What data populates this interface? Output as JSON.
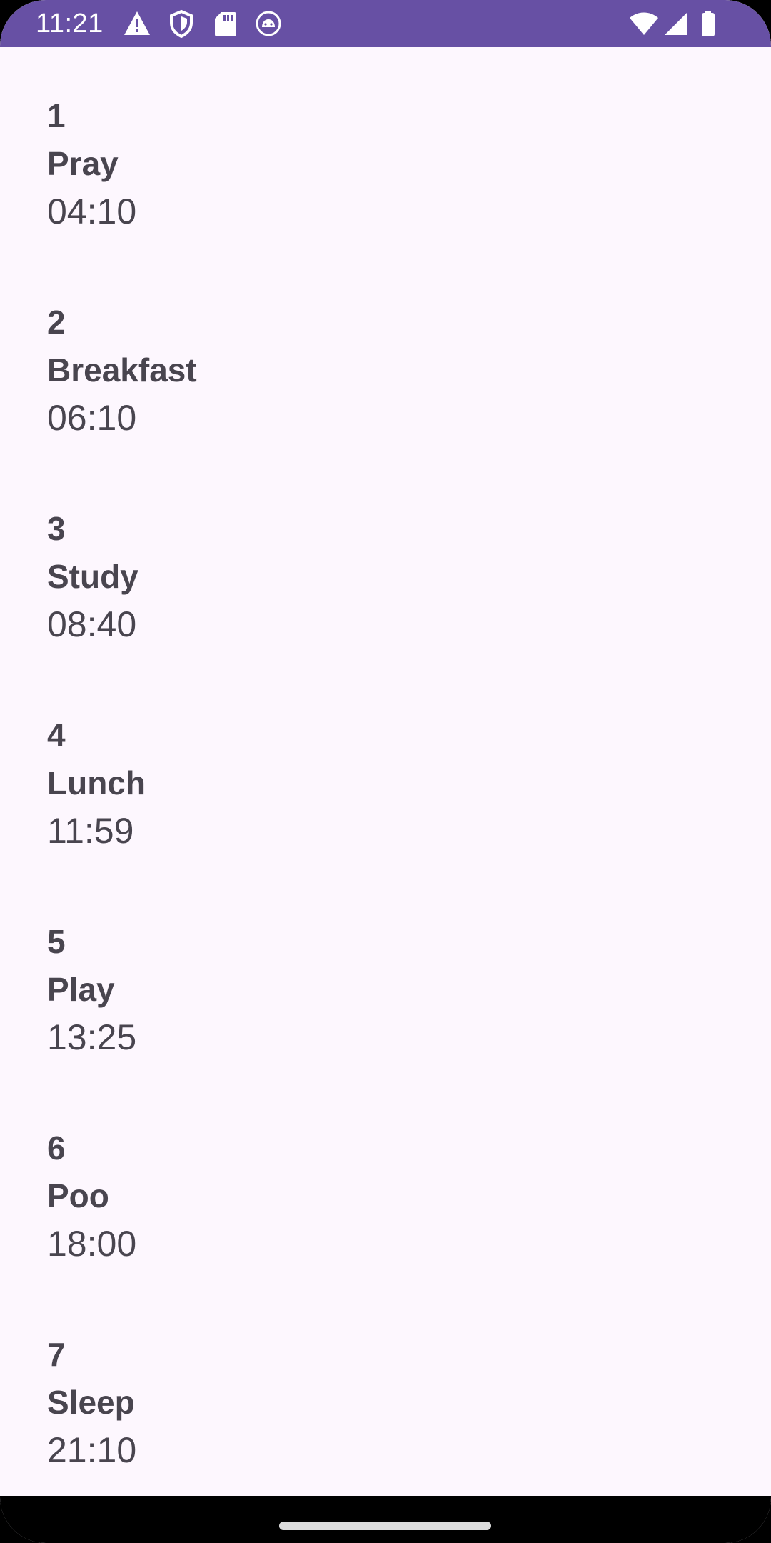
{
  "status_bar": {
    "time": "11:21",
    "left_icons": [
      "alert-icon",
      "shield-icon",
      "sd-card-icon",
      "android-debug-icon"
    ],
    "right_icons": [
      "wifi-icon",
      "cellular-signal-icon",
      "battery-icon"
    ],
    "background_color": "#6750A4"
  },
  "activities": [
    {
      "number": "1",
      "name": "Pray",
      "time": "04:10"
    },
    {
      "number": "2",
      "name": "Breakfast",
      "time": "06:10"
    },
    {
      "number": "3",
      "name": "Study",
      "time": "08:40"
    },
    {
      "number": "4",
      "name": "Lunch",
      "time": "11:59"
    },
    {
      "number": "5",
      "name": "Play",
      "time": "13:25"
    },
    {
      "number": "6",
      "name": "Poo",
      "time": "18:00"
    },
    {
      "number": "7",
      "name": "Sleep",
      "time": "21:10"
    }
  ],
  "colors": {
    "background": "#FDF7FE",
    "text": "#49454F"
  }
}
